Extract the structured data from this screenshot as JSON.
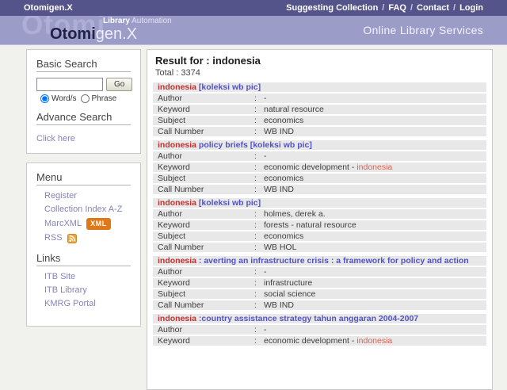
{
  "topbar": {
    "brand": "Otomigen.X",
    "separator": "/",
    "links": [
      {
        "label": "Suggesting Collection"
      },
      {
        "label": "FAQ"
      },
      {
        "label": "Contact"
      },
      {
        "label": "Login"
      }
    ]
  },
  "banner": {
    "watermark": "Otomi",
    "logo_bold": "Otomi",
    "logo_light": "gen.X",
    "tag_bold": "Library",
    "tag_light": " Automation",
    "right_title": "Online Library Services"
  },
  "sidebar": {
    "basic_search": {
      "title": "Basic Search",
      "input_value": "",
      "go_label": "Go",
      "options": [
        "Word/s",
        "Phrase"
      ],
      "selected_option": "Word/s",
      "advance_title": "Advance Search",
      "advance_link": "Click here"
    },
    "menu": {
      "title": "Menu",
      "register": "Register",
      "collection_index": "Collection Index A-Z",
      "marcxml": "MarcXML",
      "xml_badge": "XML",
      "rss": "RSS"
    },
    "links": {
      "title": "Links",
      "items": [
        "ITB Site",
        "ITB Library",
        "KMRG Portal"
      ]
    }
  },
  "results": {
    "header": "Result for : indonesia",
    "total": "Total : 3374",
    "colon": ":",
    "records": [
      {
        "title_red": "indonesia",
        "title_rest": " [koleksi wb pic]",
        "fields": [
          {
            "label": "Author",
            "value": "-",
            "hl": ""
          },
          {
            "label": "Keyword",
            "value": "natural resource",
            "hl": ""
          },
          {
            "label": "Subject",
            "value": "economics",
            "hl": ""
          },
          {
            "label": "Call Number",
            "value": "WB IND",
            "hl": ""
          }
        ]
      },
      {
        "title_red": "indonesia",
        "title_rest": " policy briefs [koleksi wb pic]",
        "fields": [
          {
            "label": "Author",
            "value": "-",
            "hl": ""
          },
          {
            "label": "Keyword",
            "value": "economic development - ",
            "hl": "indonesia"
          },
          {
            "label": "Subject",
            "value": "economics",
            "hl": ""
          },
          {
            "label": "Call Number",
            "value": "WB IND",
            "hl": ""
          }
        ]
      },
      {
        "title_red": "indonesia",
        "title_rest": " [koleksi wb pic]",
        "fields": [
          {
            "label": "Author",
            "value": "holmes, derek a.",
            "hl": ""
          },
          {
            "label": "Keyword",
            "value": "forests - natural resource",
            "hl": ""
          },
          {
            "label": "Subject",
            "value": "economics",
            "hl": ""
          },
          {
            "label": "Call Number",
            "value": "WB HOL",
            "hl": ""
          }
        ]
      },
      {
        "title_red": "indonesia",
        "title_rest": " : averting an infrastructure crisis : a framework for policy and action",
        "fields": [
          {
            "label": "Author",
            "value": "-",
            "hl": ""
          },
          {
            "label": "Keyword",
            "value": "infrastructure",
            "hl": ""
          },
          {
            "label": "Subject",
            "value": "social science",
            "hl": ""
          },
          {
            "label": "Call Number",
            "value": "WB IND",
            "hl": ""
          }
        ]
      },
      {
        "title_red": "indonesia",
        "title_rest": " :country assistance strategy tahun anggaran 2004-2007",
        "fields": [
          {
            "label": "Author",
            "value": "-",
            "hl": ""
          },
          {
            "label": "Keyword",
            "value": "economic development - ",
            "hl": "indonesia"
          }
        ]
      }
    ]
  },
  "colors": {
    "topbar_bg": "#54548a",
    "banner_bg": "#9c9cc9",
    "accent_red": "#c03030",
    "title_link_blue": "#5252c0",
    "highlight_red": "#e06050",
    "badge_orange": "#e07818"
  }
}
